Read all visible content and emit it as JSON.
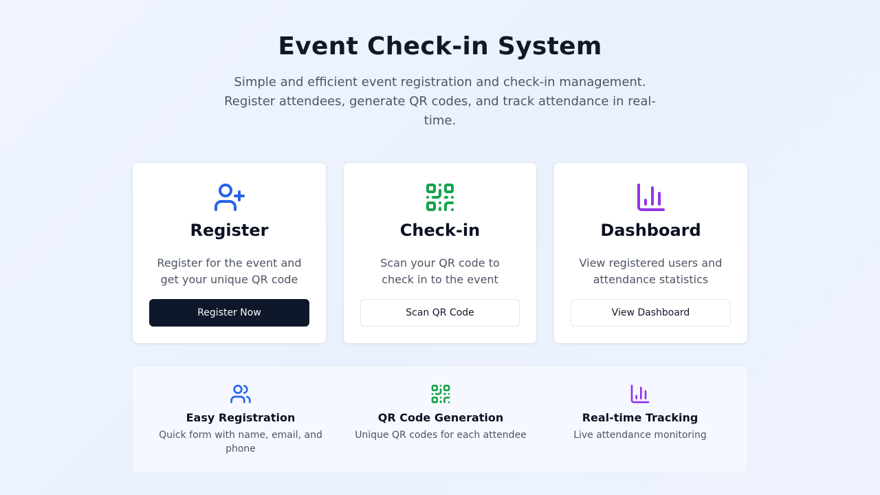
{
  "hero": {
    "title": "Event Check-in System",
    "subtitle": "Simple and efficient event registration and check-in management. Register attendees, generate QR codes, and track attendance in real-time."
  },
  "cards": [
    {
      "icon": "user-plus-icon",
      "color": "#2563eb",
      "title": "Register",
      "description": "Register for the event and get your unique QR code",
      "button": "Register Now"
    },
    {
      "icon": "qr-code-icon",
      "color": "#16a34a",
      "title": "Check-in",
      "description": "Scan your QR code to check in to the event",
      "button": "Scan QR Code"
    },
    {
      "icon": "bar-chart-icon",
      "color": "#9333ea",
      "title": "Dashboard",
      "description": "View registered users and attendance statistics",
      "button": "View Dashboard"
    }
  ],
  "features": [
    {
      "icon": "users-icon",
      "color": "#2563eb",
      "title": "Easy Registration",
      "description": "Quick form with name, email, and phone"
    },
    {
      "icon": "qr-code-icon",
      "color": "#16a34a",
      "title": "QR Code Generation",
      "description": "Unique QR codes for each attendee"
    },
    {
      "icon": "bar-chart-icon",
      "color": "#9333ea",
      "title": "Real-time Tracking",
      "description": "Live attendance monitoring"
    }
  ]
}
